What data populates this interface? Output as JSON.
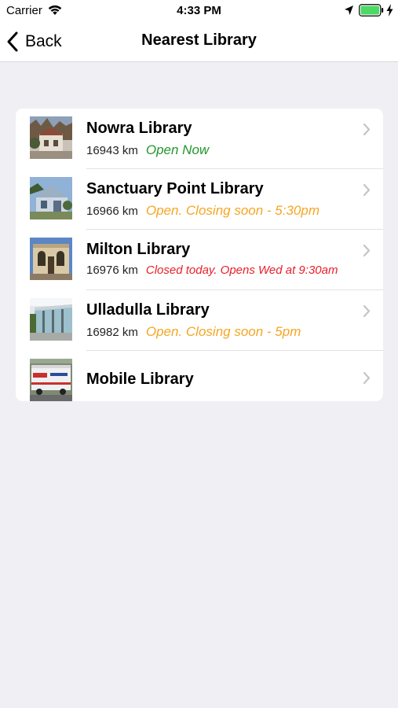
{
  "status_bar": {
    "carrier": "Carrier",
    "time": "4:33 PM",
    "icons": [
      "wifi-icon",
      "location-arrow-icon",
      "battery-icon",
      "charging-bolt-icon"
    ]
  },
  "nav": {
    "back_label": "Back",
    "title": "Nearest Library"
  },
  "colors": {
    "open_now": "#22962a",
    "closing_soon": "#f5a623",
    "closed": "#e8202a",
    "chevron": "#c4c4c8",
    "background": "#efeff4"
  },
  "libraries": [
    {
      "name": "Nowra Library",
      "distance": "16943 km",
      "status": "Open Now",
      "status_kind": "open_now"
    },
    {
      "name": "Sanctuary Point Library",
      "distance": "16966 km",
      "status": "Open. Closing soon - 5:30pm",
      "status_kind": "closing_soon"
    },
    {
      "name": "Milton Library",
      "distance": "16976 km",
      "status": "Closed today. Opens Wed at 9:30am",
      "status_kind": "closed"
    },
    {
      "name": "Ulladulla Library",
      "distance": "16982 km",
      "status": "Open. Closing soon - 5pm",
      "status_kind": "closing_soon"
    },
    {
      "name": "Mobile Library",
      "distance": "",
      "status": "",
      "status_kind": ""
    }
  ]
}
